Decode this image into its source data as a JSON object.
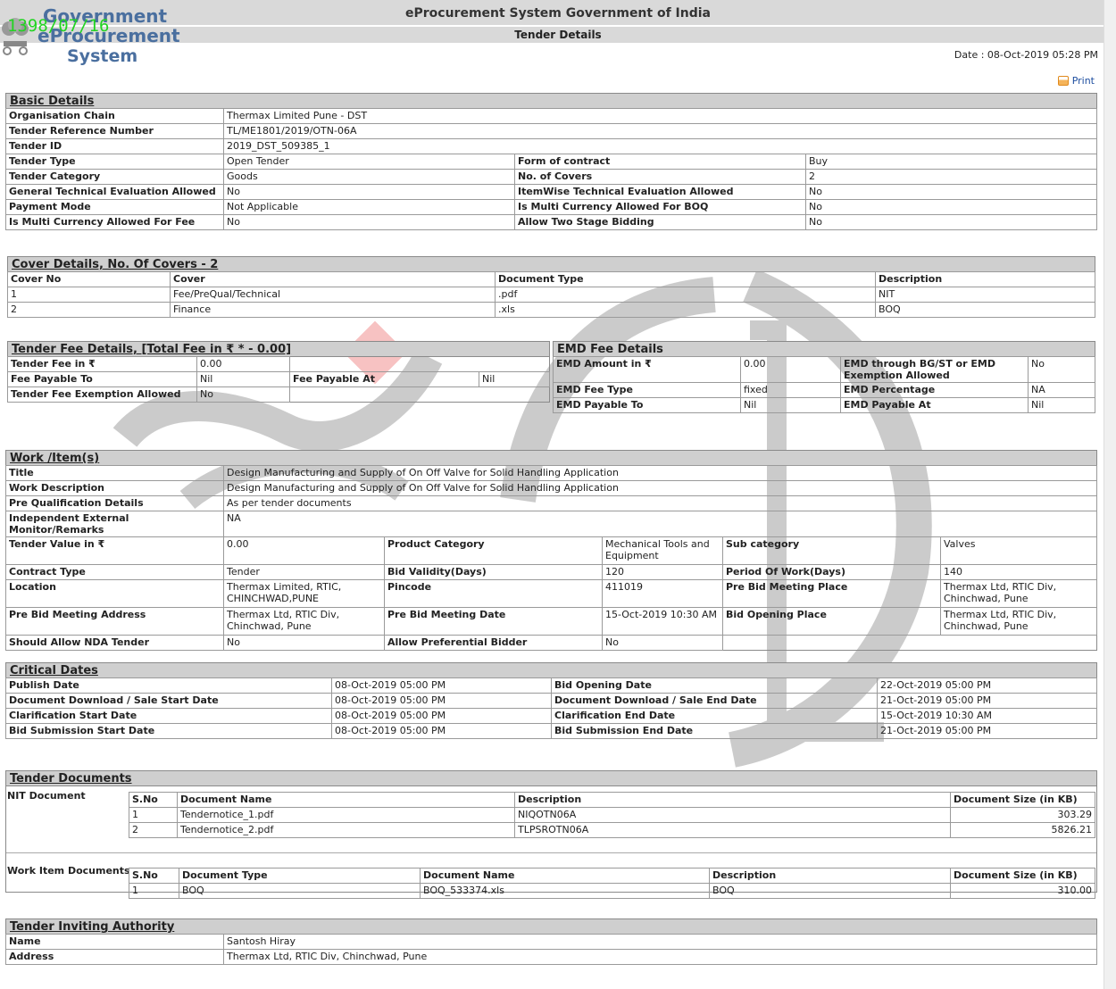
{
  "header": {
    "system_name": "eProcurement System Government of India",
    "page_title": "Tender Details",
    "logo_line1": "Government",
    "logo_line2": "eProcurement",
    "logo_line3": "System",
    "stamp": "1398/07/16",
    "date": "Date : 08-Oct-2019 05:28 PM",
    "print_label": "Print"
  },
  "basic": {
    "title": "Basic Details",
    "org_label": "Organisation Chain",
    "org_value": "Thermax Limited Pune - DST",
    "ref_label": "Tender Reference Number",
    "ref_value": "TL/ME1801/2019/OTN-06A",
    "id_label": "Tender ID",
    "id_value": "2019_DST_509385_1",
    "type_label": "Tender Type",
    "type_value": "Open Tender",
    "form_label": "Form of contract",
    "form_value": "Buy",
    "cat_label": "Tender Category",
    "cat_value": "Goods",
    "covers_label": "No. of Covers",
    "covers_value": "2",
    "gte_label": "General Technical Evaluation Allowed",
    "gte_value": "No",
    "iwte_label": "ItemWise Technical Evaluation Allowed",
    "iwte_value": "No",
    "pay_label": "Payment Mode",
    "pay_value": "Not Applicable",
    "mcboq_label": "Is Multi Currency Allowed For BOQ",
    "mcboq_value": "No",
    "mcfee_label": "Is Multi Currency Allowed For Fee",
    "mcfee_value": "No",
    "twostage_label": "Allow Two Stage Bidding",
    "twostage_value": "No"
  },
  "covers": {
    "title": "Cover Details, No. Of Covers - 2",
    "headers": [
      "Cover No",
      "Cover",
      "Document Type",
      "Description"
    ],
    "rows": [
      [
        "1",
        "Fee/PreQual/Technical",
        ".pdf",
        "NIT"
      ],
      [
        "2",
        "Finance",
        ".xls",
        "BOQ"
      ]
    ]
  },
  "fee": {
    "title": "Tender Fee Details, [Total Fee in ₹ * - 0.00]",
    "fee_label": "Tender Fee in ₹",
    "fee_value": "0.00",
    "payto_label": "Fee Payable To",
    "payto_value": "Nil",
    "payat_label": "Fee Payable At",
    "payat_value": "Nil",
    "exempt_label": "Tender Fee Exemption Allowed",
    "exempt_value": "No"
  },
  "emd": {
    "title": "EMD Fee Details",
    "amount_label": "EMD Amount in ₹",
    "amount_value": "0.00",
    "bg_label": "EMD through BG/ST or EMD Exemption Allowed",
    "bg_value": "No",
    "type_label": "EMD Fee Type",
    "type_value": "fixed",
    "pct_label": "EMD Percentage",
    "pct_value": "NA",
    "payto_label": "EMD Payable To",
    "payto_value": "Nil",
    "payat_label": "EMD Payable At",
    "payat_value": "Nil"
  },
  "work": {
    "title": "Work /Item(s)",
    "title_label": "Title",
    "title_value": "Design Manufacturing and Supply of On Off Valve for Solid Handling Application",
    "desc_label": "Work Description",
    "desc_value": "Design Manufacturing and Supply of On Off Valve for Solid Handling Application",
    "prequal_label": "Pre Qualification Details",
    "prequal_value": "As per tender documents",
    "monitor_label": "Independent External Monitor/Remarks",
    "monitor_value": "NA",
    "value_label": "Tender Value in ₹",
    "value_value": "0.00",
    "pcat_label": "Product Category",
    "pcat_value": "Mechanical Tools and Equipment",
    "subcat_label": "Sub category",
    "subcat_value": "Valves",
    "ctype_label": "Contract Type",
    "ctype_value": "Tender",
    "validity_label": "Bid Validity(Days)",
    "validity_value": "120",
    "period_label": "Period Of Work(Days)",
    "period_value": "140",
    "loc_label": "Location",
    "loc_value": "Thermax Limited, RTIC, CHINCHWAD,PUNE",
    "pin_label": "Pincode",
    "pin_value": "411019",
    "pbplace_label": "Pre Bid Meeting Place",
    "pbplace_value": "Thermax Ltd, RTIC Div, Chinchwad, Pune",
    "pbaddr_label": "Pre Bid Meeting Address",
    "pbaddr_value": "Thermax Ltd, RTIC Div, Chinchwad, Pune",
    "pbdate_label": "Pre Bid Meeting Date",
    "pbdate_value": "15-Oct-2019 10:30 AM",
    "bidopen_label": "Bid Opening Place",
    "bidopen_value": "Thermax Ltd, RTIC Div, Chinchwad, Pune",
    "nda_label": "Should Allow NDA Tender",
    "nda_value": "No",
    "pref_label": "Allow Preferential Bidder",
    "pref_value": "No"
  },
  "dates": {
    "title": "Critical Dates",
    "publish_label": "Publish Date",
    "publish_value": "08-Oct-2019 05:00 PM",
    "bidopen_label": "Bid Opening Date",
    "bidopen_value": "22-Oct-2019 05:00 PM",
    "dlstart_label": "Document Download / Sale Start Date",
    "dlstart_value": "08-Oct-2019 05:00 PM",
    "dlend_label": "Document Download / Sale End Date",
    "dlend_value": "21-Oct-2019 05:00 PM",
    "clarstart_label": "Clarification Start Date",
    "clarstart_value": "08-Oct-2019 05:00 PM",
    "clarend_label": "Clarification End Date",
    "clarend_value": "15-Oct-2019 10:30 AM",
    "subst_label": "Bid Submission Start Date",
    "subst_value": "08-Oct-2019 05:00 PM",
    "subend_label": "Bid Submission End Date",
    "subend_value": "21-Oct-2019 05:00 PM"
  },
  "docs": {
    "title": "Tender Documents",
    "nit_label": "NIT Document",
    "nit_headers": [
      "S.No",
      "Document Name",
      "Description",
      "Document Size (in KB)"
    ],
    "nit_rows": [
      [
        "1",
        "Tendernotice_1.pdf",
        "NIQOTN06A",
        "303.29"
      ],
      [
        "2",
        "Tendernotice_2.pdf",
        "TLPSROTN06A",
        "5826.21"
      ]
    ],
    "wi_label": "Work Item Documents",
    "wi_headers": [
      "S.No",
      "Document Type",
      "Document Name",
      "Description",
      "Document Size (in KB)"
    ],
    "wi_rows": [
      [
        "1",
        "BOQ",
        "BOQ_533374.xls",
        "BOQ",
        "310.00"
      ]
    ]
  },
  "authority": {
    "title": "Tender Inviting Authority",
    "name_label": "Name",
    "name_value": "Santosh Hiray",
    "addr_label": "Address",
    "addr_value": "Thermax Ltd, RTIC Div, Chinchwad, Pune"
  }
}
